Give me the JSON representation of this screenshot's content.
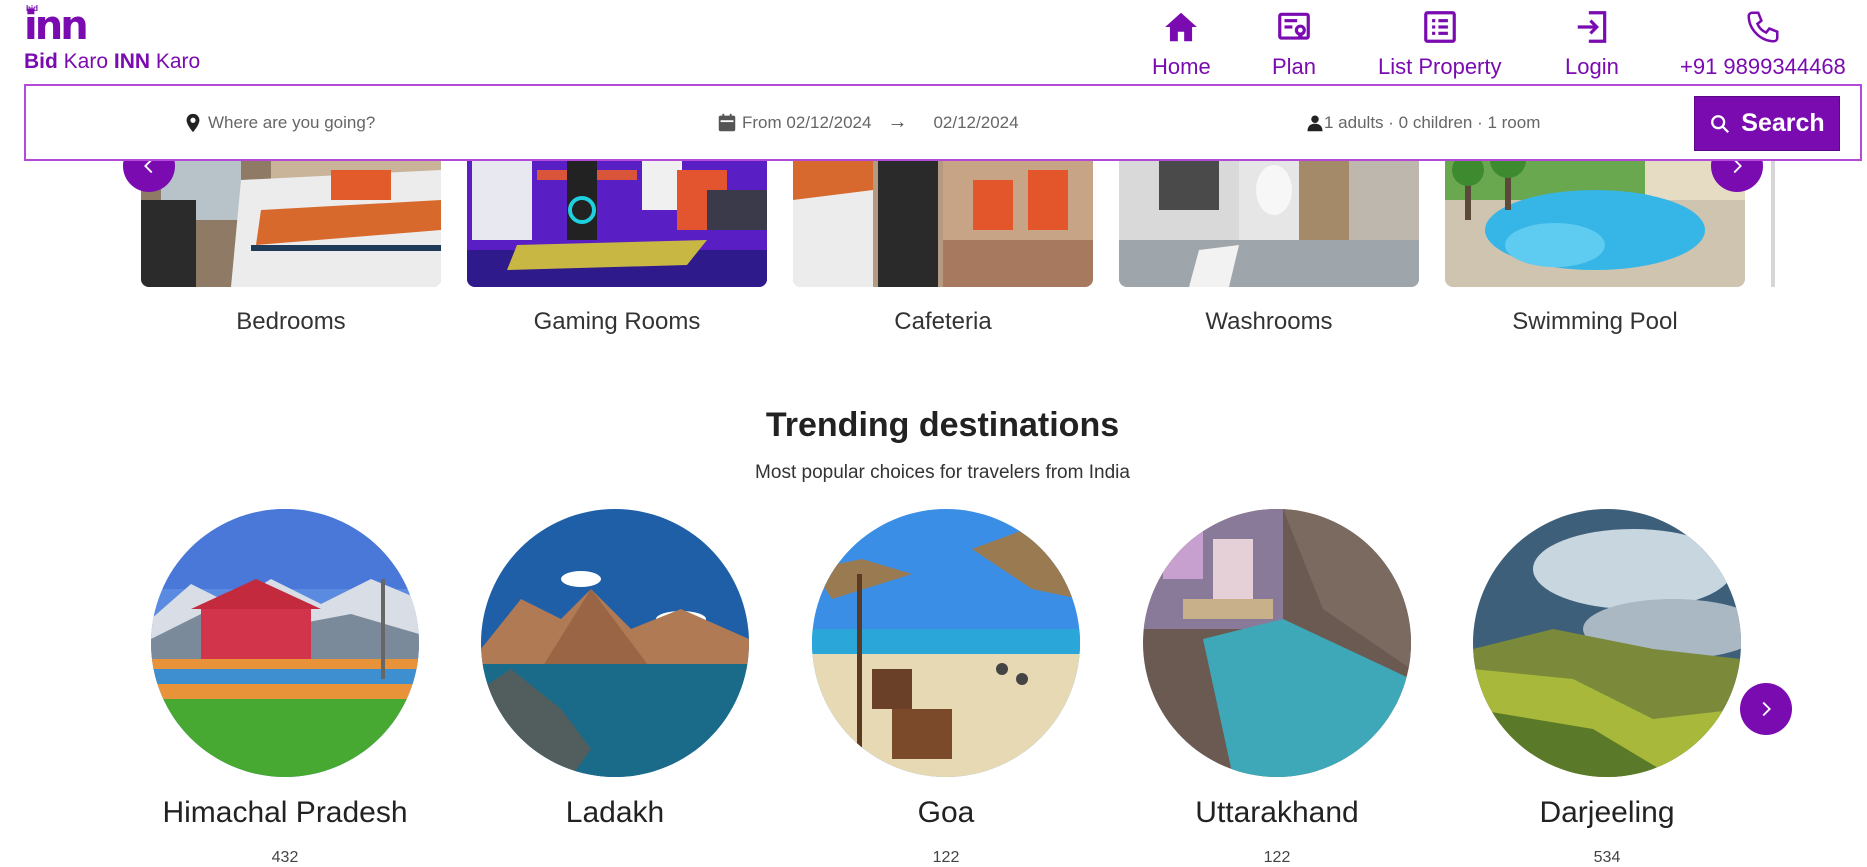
{
  "brand": {
    "logo_mark": "inn",
    "logo_small": "bid",
    "name_part1": "Bid",
    "name_part2": " Karo ",
    "name_part3": "INN",
    "name_part4": " Karo",
    "accent_color": "#7a0bb0"
  },
  "nav": {
    "home": "Home",
    "plan": "Plan",
    "list_property": "List Property",
    "login": "Login",
    "phone": "+91 9899344468"
  },
  "search": {
    "destination_placeholder": "Where are you going?",
    "date_from": "From 02/12/2024",
    "date_arrow": "→",
    "date_to": "02/12/2024",
    "guests": "1 adults · 0 children · 1 room",
    "button_label": "Search"
  },
  "rooms": {
    "items": [
      {
        "label": "Bedrooms"
      },
      {
        "label": "Gaming Rooms"
      },
      {
        "label": "Cafeteria"
      },
      {
        "label": "Washrooms"
      },
      {
        "label": "Swimming Pool"
      }
    ]
  },
  "trending": {
    "title": "Trending destinations",
    "subtitle": "Most popular choices for travelers from India",
    "destinations": [
      {
        "name": "Himachal Pradesh",
        "count": "432"
      },
      {
        "name": "Ladakh",
        "count": ""
      },
      {
        "name": "Goa",
        "count": "122"
      },
      {
        "name": "Uttarakhand",
        "count": "122"
      },
      {
        "name": "Darjeeling",
        "count": "534"
      }
    ]
  }
}
